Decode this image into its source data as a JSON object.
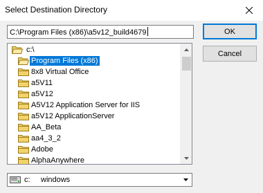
{
  "window": {
    "title": "Select Destination Directory",
    "close_icon": "close-icon"
  },
  "path_input": {
    "value": "C:\\Program Files (x86)\\a5v12_build4679"
  },
  "buttons": {
    "ok_label": "OK",
    "cancel_label": "Cancel"
  },
  "directory_tree": {
    "root": {
      "label": "c:\\",
      "icon": "open-folder-icon"
    },
    "current": {
      "label": "Program Files (x86)",
      "icon": "open-folder-icon"
    },
    "subfolders": [
      "8x8 Virtual Office",
      "a5V11",
      "a5V12",
      "A5V12 Application Server for IIS",
      "a5V12 ApplicationServer",
      "AA_Beta",
      "aa4_3_2",
      "Adobe",
      "AlphaAnywhere"
    ]
  },
  "drive_select": {
    "letter": "c:",
    "label": "windows",
    "icon": "drive-icon"
  },
  "colors": {
    "selection": "#0078d7",
    "folder_fill": "#f2d36b",
    "folder_stroke": "#9b7a1a"
  }
}
